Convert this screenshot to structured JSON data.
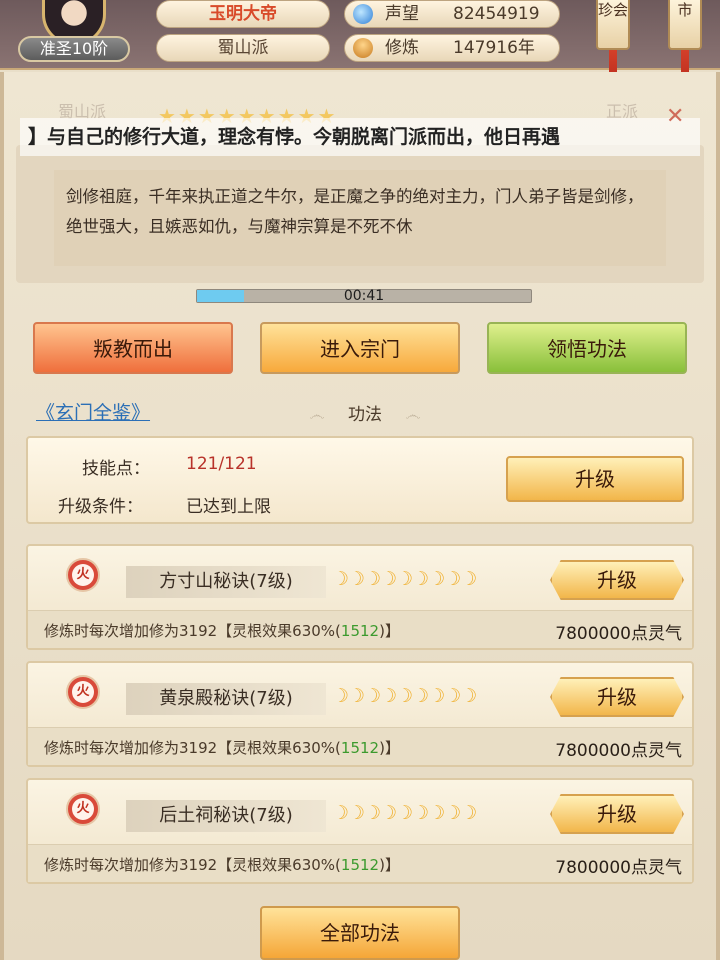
{
  "header": {
    "rank": "准圣10阶",
    "player_name": "玉明大帝",
    "sect": "蜀山派",
    "reputation_label": "声望",
    "reputation_value": "82454919",
    "cultivation_label": "修炼",
    "cultivation_value": "147916年",
    "side_btn_treasure": "珍会",
    "side_btn_market": "市"
  },
  "banner": {
    "faded_tab_left": "蜀山派",
    "faded_tab_right": "正派",
    "stars": "★★★★★★★★★",
    "close_glyph": "✕",
    "marquee": "】与自己的修行大道，理念有悖。今朝脱离门派而出，他日再遇"
  },
  "sect_desc": {
    "text": "剑修祖庭，千年来执正道之牛尔，是正魔之争的绝对主力，门人弟子皆是剑修，绝世强大，且嫉恶如仇，与魔神宗算是不死不休"
  },
  "timer": {
    "text": "00:41",
    "progress": 0.14
  },
  "actions": {
    "betray": "叛教而出",
    "enter": "进入宗门",
    "comprehend": "领悟功法"
  },
  "links": {
    "encyclopedia": "《玄门全鉴》"
  },
  "section": {
    "title": "功法",
    "swirl": "෴"
  },
  "skill_points": {
    "label": "技能点：",
    "value": "121/121",
    "cond_label": "升级条件：",
    "cond_value": "已达到上限",
    "upgrade": "升级"
  },
  "skills": [
    {
      "element": "火",
      "name": "方寸山秘诀(7级)",
      "moons": "☽☽☽☽☽☽☽☽☽",
      "upgrade": "升级",
      "desc_prefix": "修炼时每次增加修为3192【灵根效果630%(",
      "desc_green": "1512",
      "desc_suffix": ")】",
      "cost": "7800000点灵气"
    },
    {
      "element": "火",
      "name": "黄泉殿秘诀(7级)",
      "moons": "☽☽☽☽☽☽☽☽☽",
      "upgrade": "升级",
      "desc_prefix": "修炼时每次增加修为3192【灵根效果630%(",
      "desc_green": "1512",
      "desc_suffix": ")】",
      "cost": "7800000点灵气"
    },
    {
      "element": "火",
      "name": "后土祠秘诀(7级)",
      "moons": "☽☽☽☽☽☽☽☽☽",
      "upgrade": "升级",
      "desc_prefix": "修炼时每次增加修为3192【灵根效果630%(",
      "desc_green": "1512",
      "desc_suffix": ")】",
      "cost": "7800000点灵气"
    }
  ],
  "footer": {
    "all_skills": "全部功法"
  },
  "colors": {
    "name_red": "#d84a2a",
    "link_blue": "#2b6fb6",
    "green_value": "#3c9a2e",
    "progress_fill": "#6ecbf0"
  }
}
